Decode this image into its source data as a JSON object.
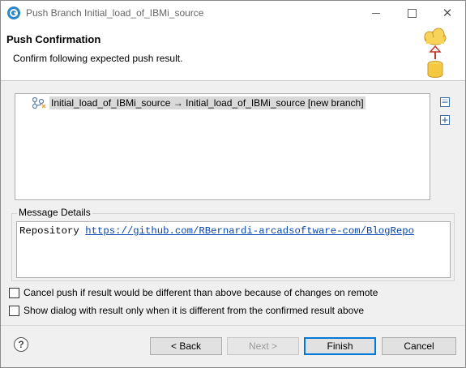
{
  "window": {
    "title": "Push Branch Initial_load_of_IBMi_source",
    "icons": {
      "app": "egit-app-icon",
      "minimize": "minimize-icon",
      "maximize": "maximize-icon",
      "close": "close-icon"
    }
  },
  "banner": {
    "title": "Push Confirmation",
    "description": "Confirm following expected push result.",
    "icon": "cloud-push-database-icon"
  },
  "result_tree": {
    "items": [
      {
        "label": "Initial_load_of_IBMi_source → Initial_load_of_IBMi_source [new branch]",
        "icon": "branch-icon",
        "selected": true
      }
    ],
    "collapse_all_icon": "collapse-all-icon",
    "expand_all_icon": "expand-all-icon"
  },
  "message_details": {
    "legend": "Message Details",
    "prefix": "Repository",
    "link": "https://github.com/RBernardi-arcadsoftware-com/BlogRepo"
  },
  "options": {
    "cancel_if_different": {
      "label": "Cancel push if result would be different than above because of changes on remote",
      "checked": false
    },
    "show_only_if_different": {
      "label": "Show dialog with result only when it is different from the confirmed result above",
      "checked": false
    }
  },
  "footer": {
    "help_icon": "help-icon",
    "back_label": "< Back",
    "next_label": "Next >",
    "finish_label": "Finish",
    "cancel_label": "Cancel",
    "next_enabled": false
  },
  "colors": {
    "finish_border": "#0078d7",
    "link": "#0645ad",
    "app_icon": "#2a86c9"
  }
}
